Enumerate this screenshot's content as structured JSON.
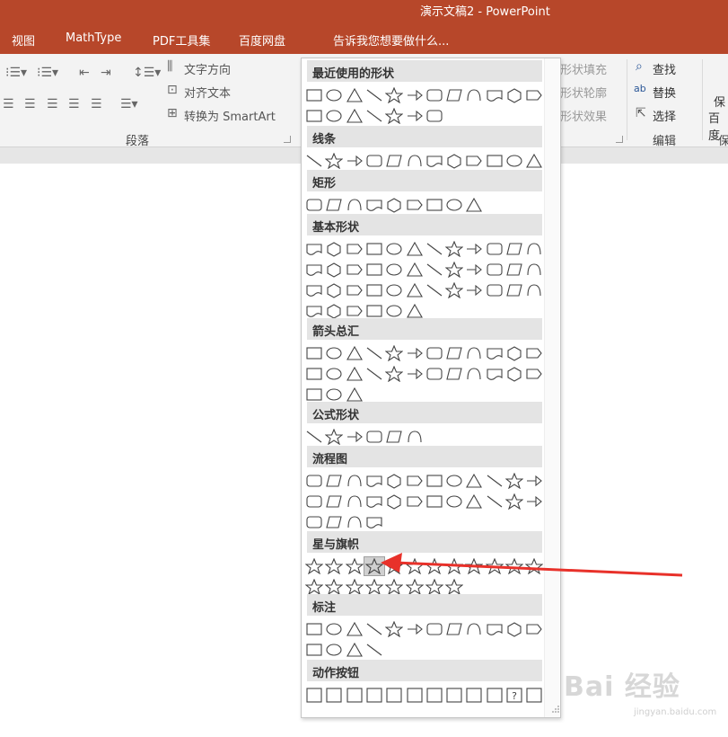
{
  "window": {
    "title": "演示文稿2 - PowerPoint"
  },
  "menubar": {
    "tabs": [
      "视图",
      "MathType",
      "PDF工具集",
      "百度网盘"
    ],
    "tell_me": "告诉我您想要做什么..."
  },
  "ribbon": {
    "text_direction": "文字方向",
    "align_text": "对齐文本",
    "convert_smartart": "转换为 SmartArt",
    "paragraph_group": "段落",
    "shape_fill": "形状填充",
    "shape_outline": "形状轮廓",
    "shape_effects": "形状效果",
    "find": "查找",
    "replace": "替换",
    "select": "选择",
    "edit_group": "编辑",
    "right_cut1": "保",
    "right_cut2": "百度",
    "right_cut3": "保"
  },
  "shapes_menu": {
    "sections": [
      {
        "name": "最近使用的形状",
        "shape_count": 19
      },
      {
        "name": "线条",
        "shape_count": 12
      },
      {
        "name": "矩形",
        "shape_count": 9
      },
      {
        "name": "基本形状",
        "shape_count": 42
      },
      {
        "name": "箭头总汇",
        "shape_count": 27
      },
      {
        "name": "公式形状",
        "shape_count": 6
      },
      {
        "name": "流程图",
        "shape_count": 28
      },
      {
        "name": "星与旗帜",
        "shape_count": 20,
        "selected_index": 3
      },
      {
        "name": "标注",
        "shape_count": 16
      },
      {
        "name": "动作按钮",
        "shape_count": 12
      }
    ],
    "action_button_glyphs": [
      "?"
    ]
  },
  "annotation": {
    "color": "#e8312a"
  },
  "watermark": {
    "logo": "Bai 经验",
    "url": "jingyan.baidu.com"
  },
  "colors": {
    "titlebar": "#b7472a",
    "ribbon": "#f3f3f3"
  }
}
